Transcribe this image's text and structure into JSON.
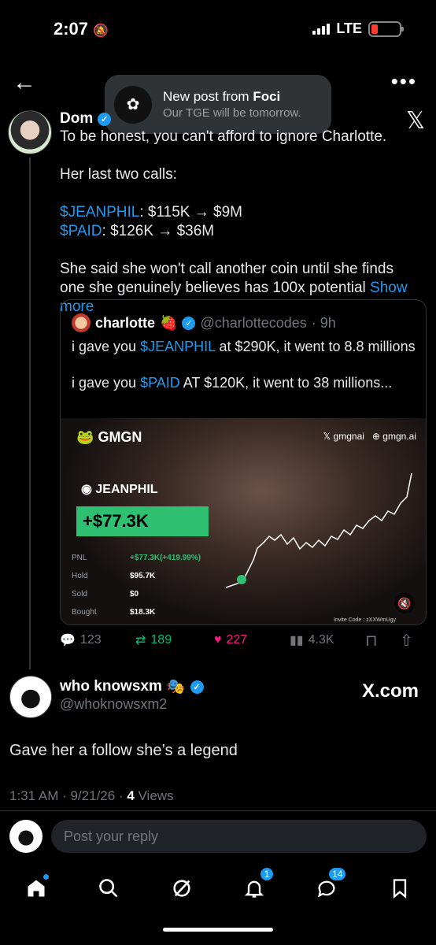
{
  "status_bar": {
    "time": "2:07",
    "network": "LTE"
  },
  "toast": {
    "title_prefix": "New post from ",
    "title_name": "Foci",
    "subtitle": "Our TGE will be tomorrow."
  },
  "post": {
    "author": "Dom",
    "text_intro": "To be honest, you can't afford to ignore Charlotte.",
    "text_calls_heading": "Her last two calls:",
    "call1_ticker": "$JEANPHIL",
    "call1_rest": ": $115K → $9M",
    "call2_ticker": "$PAID",
    "call2_rest": ": $126K → $36M",
    "text_closing": "She said she won't call another coin until she finds one she genuinely believes has 100x potential ",
    "show_more": "Show more"
  },
  "quote": {
    "name": "charlotte",
    "emoji": "🍓",
    "handle": "@charlottecodes",
    "time": "· 9h",
    "line1_a": "i gave you ",
    "line1_ticker": "$JEANPHIL",
    "line1_b": " at $290K, it went to 8.8 millions",
    "line2_a": "i gave you ",
    "line2_ticker": "$PAID",
    "line2_b": " AT $120K, it went to 38 millions...",
    "media": {
      "brand": "GMGN",
      "link1": "gmgnai",
      "link2": "gmgn.ai",
      "token": "JEANPHIL",
      "pnl_big": "+$77.3K",
      "stats": [
        {
          "label": "PNL",
          "value": "+$77.3K(+419.99%)"
        },
        {
          "label": "Hold",
          "value": "$95.7K"
        },
        {
          "label": "Sold",
          "value": "$0"
        },
        {
          "label": "Bought",
          "value": "$18.3K"
        }
      ],
      "invite": "Invite Code : zXXWmUgy"
    }
  },
  "actions": {
    "replies": "123",
    "reposts": "189",
    "likes": "227",
    "views": "4.3K"
  },
  "reply": {
    "name": "who knowsxm",
    "emoji": "🎭",
    "handle": "@whoknowsxm2",
    "watermark": "X.com",
    "text": "Gave her a follow she’s a legend",
    "meta_time": "1:31 AM · 9/21/26 · ",
    "meta_views_count": "4",
    "meta_views_label": " Views"
  },
  "composer": {
    "placeholder": "Post your reply"
  },
  "tabbar": {
    "notifications_badge": "1",
    "messages_badge": "14"
  },
  "colors": {
    "accent": "#1d9bf0",
    "repost": "#00ba7c",
    "like": "#f91880",
    "gmgn_green": "#2fbf71"
  }
}
